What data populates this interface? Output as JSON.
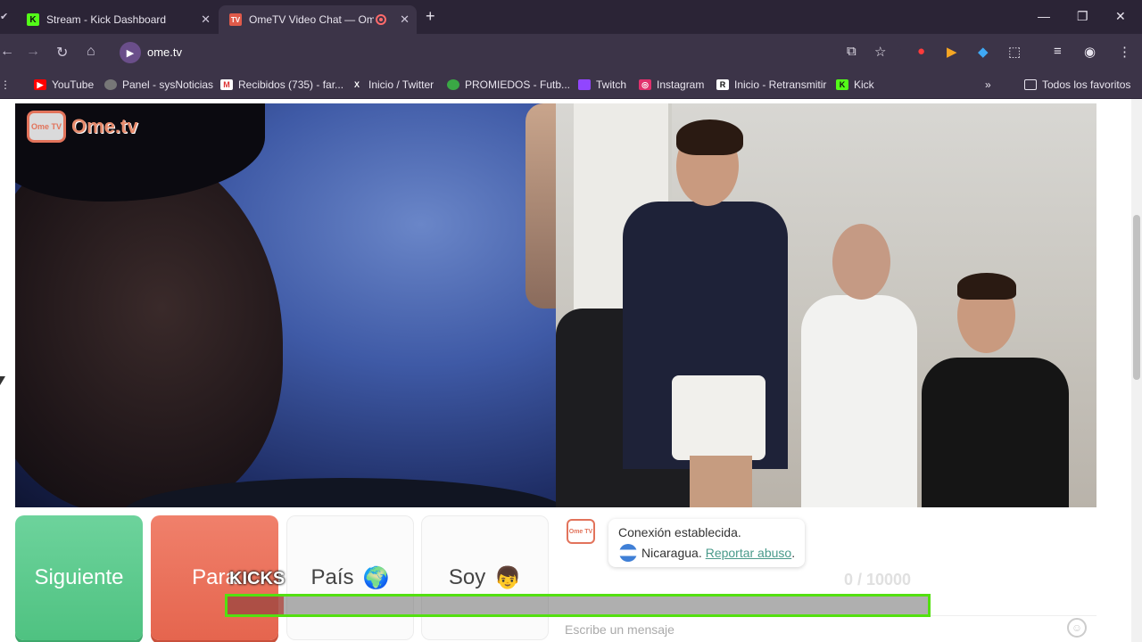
{
  "browser": {
    "tabs": [
      {
        "title": "Stream - Kick Dashboard",
        "active": false
      },
      {
        "title": "OmeTV Video Chat — Ome",
        "active": true
      }
    ],
    "url": "ome.tv",
    "bookmarks": [
      {
        "label": "YouTube",
        "icon": "youtube-icon"
      },
      {
        "label": "Panel - sysNoticias",
        "icon": "globe-icon"
      },
      {
        "label": "Recibidos (735) - far...",
        "icon": "gmail-icon"
      },
      {
        "label": "Inicio / Twitter",
        "icon": "x-icon"
      },
      {
        "label": "PROMIEDOS - Futb...",
        "icon": "ball-icon"
      },
      {
        "label": "Twitch",
        "icon": "twitch-icon"
      },
      {
        "label": "Instagram",
        "icon": "instagram-icon"
      },
      {
        "label": "Inicio - Retransmitir",
        "icon": "restream-icon"
      },
      {
        "label": "Kick",
        "icon": "kick-icon"
      }
    ],
    "all_bookmarks": "Todos los favoritos"
  },
  "page": {
    "logo_text": "Ome.tv",
    "logo_badge": "Ome TV",
    "buttons": {
      "next": "Siguiente",
      "stop": "Para",
      "country": "País",
      "country_emoji": "🌍",
      "soy": "Soy",
      "soy_emoji": "👦"
    },
    "chat": {
      "connected": "Conexión establecida.",
      "country": "Nicaragua.",
      "report": "Reportar abuso",
      "report_suffix": ".",
      "counter": "0  / 10000",
      "placeholder": "Escribe un mensaje"
    }
  },
  "overlay": {
    "label": "KICKS",
    "progress": 0.08
  }
}
